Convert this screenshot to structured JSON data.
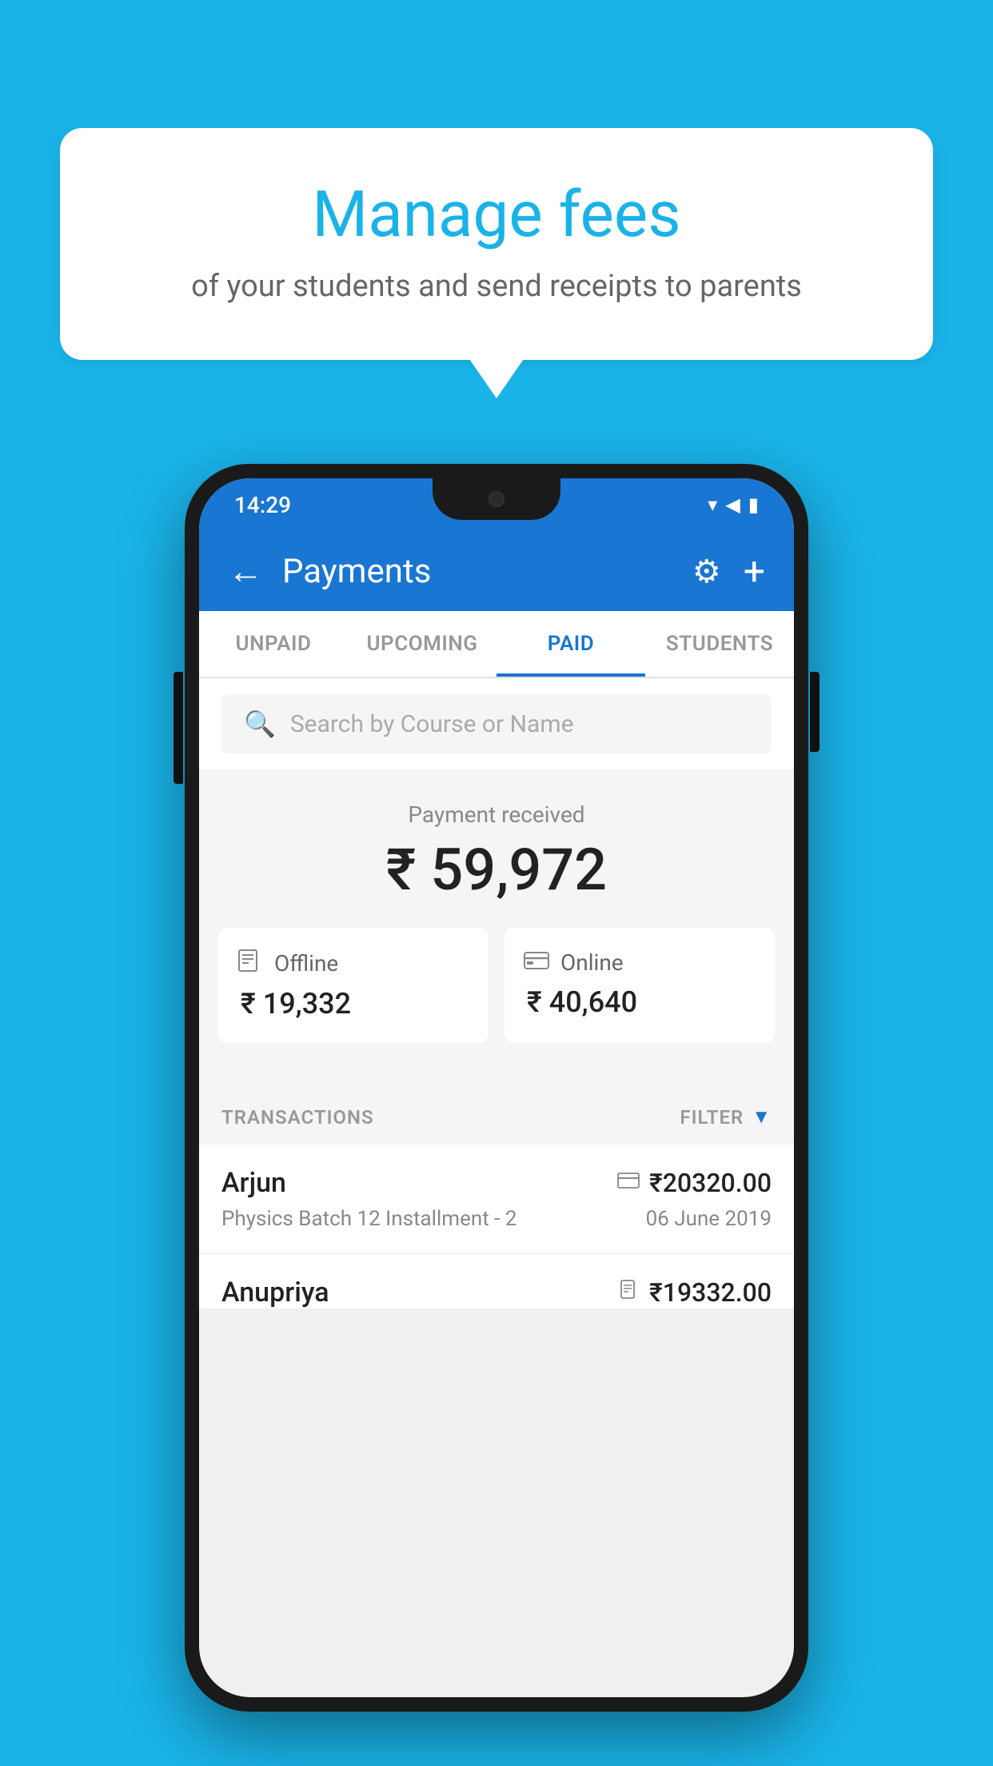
{
  "background_color": "#1ab3e8",
  "speech_bubble": {
    "title": "Manage fees",
    "subtitle": "of your students and send receipts to parents"
  },
  "phone": {
    "status_bar": {
      "time": "14:29",
      "icons": [
        "▲",
        "▲",
        "▮"
      ]
    },
    "header": {
      "title": "Payments",
      "back_icon": "←",
      "gear_icon": "⚙",
      "plus_icon": "+"
    },
    "tabs": [
      {
        "label": "UNPAID",
        "active": false
      },
      {
        "label": "UPCOMING",
        "active": false
      },
      {
        "label": "PAID",
        "active": true
      },
      {
        "label": "STUDENTS",
        "active": false
      }
    ],
    "search": {
      "placeholder": "Search by Course or Name"
    },
    "payment_summary": {
      "label": "Payment received",
      "amount": "₹ 59,972",
      "offline": {
        "label": "Offline",
        "amount": "₹ 19,332"
      },
      "online": {
        "label": "Online",
        "amount": "₹ 40,640"
      }
    },
    "transactions_label": "TRANSACTIONS",
    "filter_label": "FILTER",
    "transactions": [
      {
        "name": "Arjun",
        "course": "Physics Batch 12 Installment - 2",
        "amount": "₹20320.00",
        "date": "06 June 2019",
        "method": "card"
      },
      {
        "name": "Anupriya",
        "amount": "₹19332.00",
        "method": "offline"
      }
    ]
  }
}
